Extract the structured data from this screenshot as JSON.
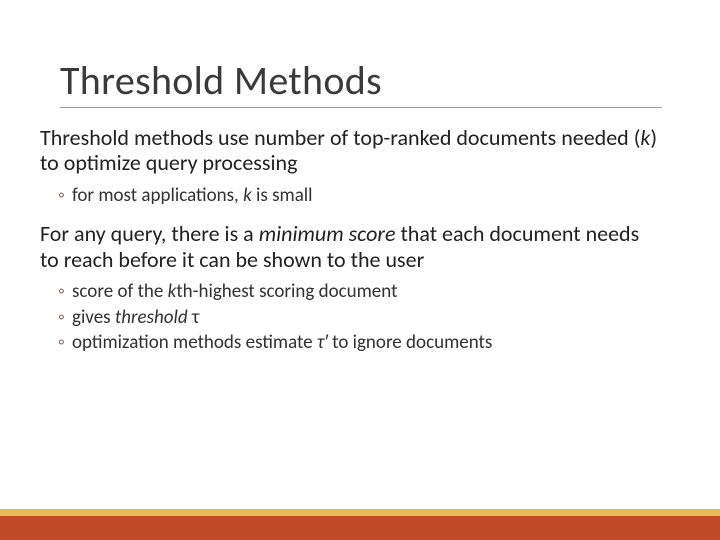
{
  "title": "Threshold Methods",
  "para1": {
    "prefix": "Threshold methods use number of top-ranked documents needed (",
    "k": "k",
    "suffix": ") to optimize query processing"
  },
  "sub1": {
    "prefix": "for most applications, ",
    "k": "k",
    "suffix": " is small"
  },
  "para2": {
    "prefix": "For any query, there is a ",
    "em": "minimum score",
    "suffix": " that each document needs to reach before it can be shown to the user"
  },
  "sub2a": {
    "prefix": "score of the ",
    "k": "k",
    "suffix": "th-highest scoring document"
  },
  "sub2b": {
    "prefix": "gives ",
    "em": "threshold",
    "tau": " τ"
  },
  "sub2c": {
    "prefix": "optimization methods estimate ",
    "tau": "τ′",
    "suffix": " to ignore documents"
  }
}
